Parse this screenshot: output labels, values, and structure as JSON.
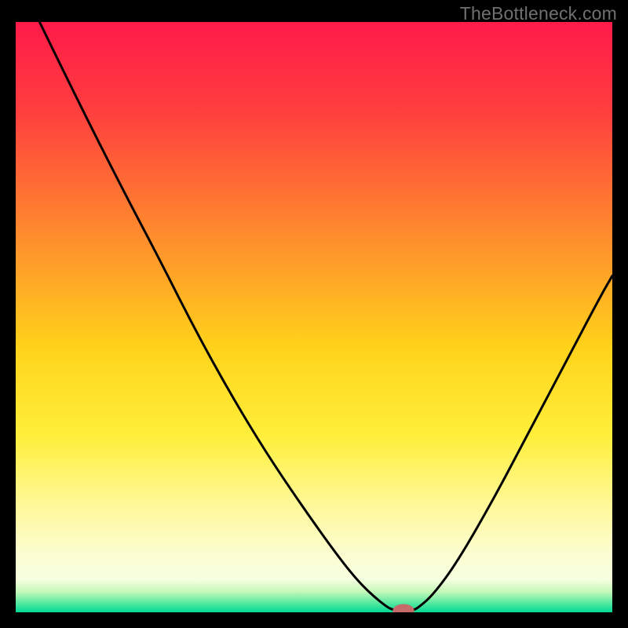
{
  "attribution": "TheBottleneck.com",
  "chart_data": {
    "type": "line",
    "title": "",
    "xlabel": "",
    "ylabel": "",
    "xlim": [
      0,
      100
    ],
    "ylim": [
      0,
      100
    ],
    "gradient_stops": [
      {
        "offset": 0.0,
        "color": "#ff1a4a"
      },
      {
        "offset": 0.15,
        "color": "#ff3e3e"
      },
      {
        "offset": 0.4,
        "color": "#ff9a2a"
      },
      {
        "offset": 0.55,
        "color": "#ffd21a"
      },
      {
        "offset": 0.7,
        "color": "#ffef3a"
      },
      {
        "offset": 0.82,
        "color": "#fff89a"
      },
      {
        "offset": 0.9,
        "color": "#fcfdd0"
      },
      {
        "offset": 0.945,
        "color": "#f5ffe0"
      },
      {
        "offset": 0.965,
        "color": "#c5f8b8"
      },
      {
        "offset": 0.985,
        "color": "#52e8a0"
      },
      {
        "offset": 1.0,
        "color": "#00d992"
      }
    ],
    "series": [
      {
        "name": "bottleneck-curve",
        "x": [
          4.0,
          10.0,
          18.0,
          24.0,
          30.0,
          36.0,
          42.0,
          48.0,
          54.0,
          58.0,
          62.0,
          63.5,
          66.5,
          67.5,
          70.0,
          74.0,
          80.0,
          86.0,
          92.0,
          98.0,
          100.0
        ],
        "y": [
          100.0,
          87.5,
          71.5,
          60.0,
          48.0,
          37.0,
          27.0,
          18.0,
          9.5,
          4.5,
          1.0,
          0.3,
          0.3,
          0.8,
          3.0,
          8.5,
          19.0,
          30.5,
          42.0,
          53.5,
          57.0
        ]
      }
    ],
    "marker": {
      "color": "#c76a6a",
      "x": 65.0,
      "y": 0.3,
      "rx": 1.8,
      "ry": 1.1
    }
  }
}
